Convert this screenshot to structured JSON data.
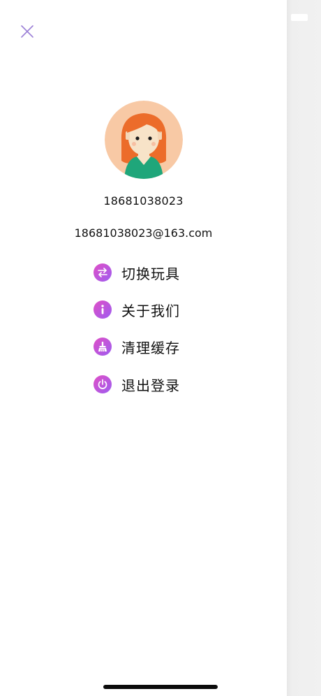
{
  "user": {
    "phone": "18681038023",
    "email": "18681038023@163.com"
  },
  "menu": {
    "items": [
      {
        "label": "切换玩具",
        "icon": "switch-arrows-icon"
      },
      {
        "label": "关于我们",
        "icon": "info-icon"
      },
      {
        "label": "清理缓存",
        "icon": "broom-icon"
      },
      {
        "label": "退出登录",
        "icon": "power-icon"
      }
    ]
  },
  "colors": {
    "accent_gradient_start": "#e04fc6",
    "accent_gradient_end": "#9d5cf0",
    "close_icon": "#9b7fd6",
    "avatar_bg": "#f8c9a5",
    "hair": "#ec6c2a",
    "shirt": "#1fa67a"
  }
}
